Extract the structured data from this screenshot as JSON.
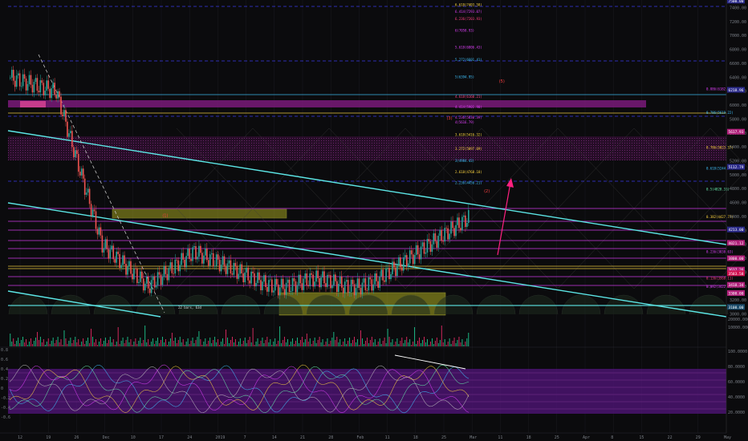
{
  "chart_data": [
    {
      "type": "candlestick",
      "title": "",
      "x_tick_labels": [
        "12",
        "19",
        "26",
        "Dec",
        "10",
        "17",
        "24",
        "2019",
        "7",
        "14",
        "21",
        "28",
        "Feb",
        "11",
        "18",
        "25",
        "Mar",
        "11",
        "18",
        "25",
        "Apr",
        "8",
        "15",
        "22",
        "29",
        "May"
      ],
      "y_tick_labels": [
        "7400.00",
        "7200.00",
        "7000.00",
        "6800.00",
        "6600.00",
        "6400.00",
        "6200.00",
        "6000.00",
        "5800.00",
        "5600.00",
        "5400.00",
        "5200.00",
        "5000.00",
        "4800.00",
        "4600.00",
        "4400.00",
        "4200.00",
        "4000.00",
        "3800.00",
        "3600.00",
        "3400.00",
        "3200.00",
        "3000.00"
      ],
      "ylim": [
        3000,
        7400
      ],
      "price_badges": [
        {
          "value": "7500.00",
          "color": "#2a2a8a"
        },
        {
          "value": "6218.96",
          "color": "#2a2a8a"
        },
        {
          "value": "5617.93",
          "color": "#b0207a"
        },
        {
          "value": "5112.79",
          "color": "#2a2a8a"
        },
        {
          "value": "4213.00",
          "color": "#2a2a8a"
        },
        {
          "value": "4021.12",
          "color": "#b0207a"
        },
        {
          "value": "3800.00",
          "color": "#b0207a"
        },
        {
          "value": "3637.26",
          "color": "#b0207a"
        },
        {
          "value": "3583.58",
          "color": "#d01050"
        },
        {
          "value": "3418.34",
          "color": "#b0207a"
        },
        {
          "value": "3300.00",
          "color": "#b0207a"
        },
        {
          "value": "3100.00",
          "color": "#1a4a6a"
        }
      ],
      "fib_labels": [
        {
          "text": "6.618(7403.58)",
          "color": "#ffd740",
          "value": 7430
        },
        {
          "text": "6.414(7293.07)",
          "color": "#e040fb",
          "value": 7330
        },
        {
          "text": "6.236(7203.93)",
          "color": "#ff4081",
          "value": 7230
        },
        {
          "text": "6(7058.93)",
          "color": "#e040fb",
          "value": 7060
        },
        {
          "text": "5.618(6806.43)",
          "color": "#e040fb",
          "value": 6820
        },
        {
          "text": "5.272(6601.41)",
          "color": "#40c4ff",
          "value": 6640
        },
        {
          "text": "5(6394.95)",
          "color": "#40c4ff",
          "value": 6390
        },
        {
          "text": "4.618(6160.21)",
          "color": "#ff4081",
          "value": 6110
        },
        {
          "text": "4.414(5901.90)",
          "color": "#e040fb",
          "value": 5960
        },
        {
          "text": "4.236(5830.39)",
          "color": "#e040fb",
          "value": 5810
        },
        {
          "text": "4(5616.79)",
          "color": "#e040fb",
          "value": 5740
        },
        {
          "text": "3.618(5416.32)",
          "color": "#ffd740",
          "value": 5560
        },
        {
          "text": "3.272(5097.69)",
          "color": "#ffd740",
          "value": 5360
        },
        {
          "text": "3(4984.43)",
          "color": "#40c4ff",
          "value": 5190
        },
        {
          "text": "2.618(4768.18)",
          "color": "#ffd740",
          "value": 5030
        },
        {
          "text": "2.236(4456.21)",
          "color": "#40c4ff",
          "value": 4870
        }
      ],
      "right_fib_labels": [
        {
          "text": "0.886(6182.47)",
          "color": "#e040fb",
          "value": 6220
        },
        {
          "text": "0.786(5619.22)",
          "color": "#40c4ff",
          "value": 5880
        },
        {
          "text": "0.786(5023.37)",
          "color": "#ffd740",
          "value": 5380
        },
        {
          "text": "0.618(5244.63)",
          "color": "#40c4ff",
          "value": 5080
        },
        {
          "text": "0.5(4828.33)",
          "color": "#69f0ae",
          "value": 4780
        },
        {
          "text": "0.382(4427.77)",
          "color": "#ffd740",
          "value": 4380
        },
        {
          "text": "0.236(3838.63)",
          "color": "#e040fb",
          "value": 3880
        },
        {
          "text": "0.136(3568.11)",
          "color": "#ff4081",
          "value": 3500
        },
        {
          "text": "0.092(3422.05)",
          "color": "#e040fb",
          "value": 3380
        }
      ],
      "wave_labels": [
        {
          "text": "(5)",
          "color": "#ff4040",
          "x_frac": 0.71,
          "value": 6330
        },
        {
          "text": "(3)",
          "color": "#ff4040",
          "x_frac": 0.64,
          "value": 5800
        },
        {
          "text": "(1)",
          "color": "#ff4040",
          "x_frac": 0.26,
          "value": 4400
        },
        {
          "text": "(2)",
          "color": "#ff4040",
          "x_frac": 0.69,
          "value": 4750
        }
      ],
      "annotations": [
        {
          "text": "22 bars, 63d",
          "value": 3080
        }
      ],
      "volume_axis_labels": [
        "20000.0000",
        "10000.0000"
      ],
      "volume_counts_note": "volume histogram (green/red bars)"
    },
    {
      "type": "oscillator",
      "title": "",
      "y_tick_labels": [
        "0.8",
        "0.6",
        "0.4",
        "0.2",
        "0",
        "-0.2",
        "-0.4",
        "-0.6"
      ],
      "right_tick_labels": [
        "100.0000",
        "80.0000",
        "60.0000",
        "40.0000",
        "20.0000"
      ]
    }
  ],
  "colors": {
    "background": "#0b0b0d",
    "candle_up": "#26a69a",
    "candle_down": "#ef5350",
    "channel": "#5ce6e6",
    "magenta_band": "#7a1a7a",
    "yellow_zone": "#a0a020",
    "arrow": "#ff2080"
  }
}
